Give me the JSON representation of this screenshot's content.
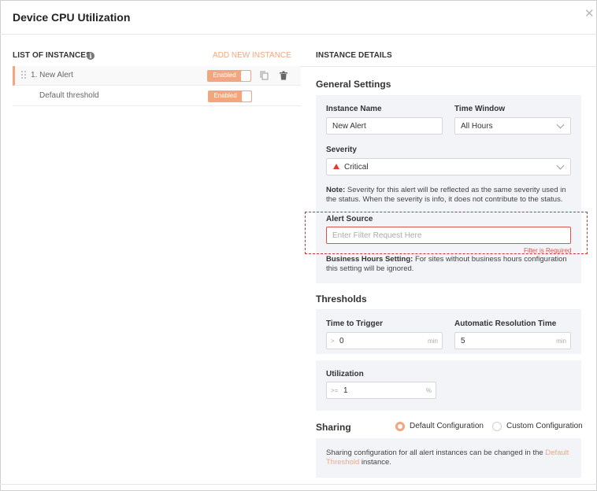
{
  "dialog": {
    "title": "Device CPU Utilization",
    "close_icon": "close-icon"
  },
  "left_panel": {
    "header": "LIST OF INSTANCES",
    "add_link": "ADD NEW INSTANCE",
    "instances": [
      {
        "label": "1. New Alert",
        "toggle": "Enabled"
      },
      {
        "label": "Default threshold",
        "toggle": "Enabled"
      }
    ]
  },
  "right_panel": {
    "header": "INSTANCE DETAILS",
    "general": {
      "title": "General Settings",
      "instance_name_label": "Instance Name",
      "instance_name_value": "New Alert",
      "time_window_label": "Time Window",
      "time_window_value": "All Hours",
      "severity_label": "Severity",
      "severity_value": "Critical",
      "note_bold": "Note:",
      "note_text": " Severity for this alert will be reflected as the same severity used in the status. When the severity is info, it does not contribute to the status.",
      "alert_source_label": "Alert Source",
      "alert_source_placeholder": "Enter Filter Request Here",
      "alert_source_error": "Filter is Required",
      "business_bold": "Business Hours Setting:",
      "business_text": " For sites without business hours configuration this setting will be ignored."
    },
    "thresholds": {
      "title": "Thresholds",
      "trigger_label": "Time to Trigger",
      "trigger_prefix": ">",
      "trigger_value": "0",
      "trigger_unit": "min",
      "resolution_label": "Automatic Resolution Time",
      "resolution_value": "5",
      "resolution_unit": "min",
      "utilization_label": "Utilization",
      "utilization_prefix": ">=",
      "utilization_value": "1",
      "utilization_unit": "%"
    },
    "sharing": {
      "title": "Sharing",
      "option_default": "Default Configuration",
      "option_custom": "Custom Configuration",
      "selected": "Default Configuration",
      "text_before": "Sharing configuration for all alert instances can be changed in the ",
      "link": "Default Threshold",
      "text_after": " instance."
    }
  },
  "colors": {
    "accent": "#f2a67f",
    "error": "#d32f2f",
    "panel_bg": "#f2f4f8",
    "severity_icon": "#e53935"
  }
}
